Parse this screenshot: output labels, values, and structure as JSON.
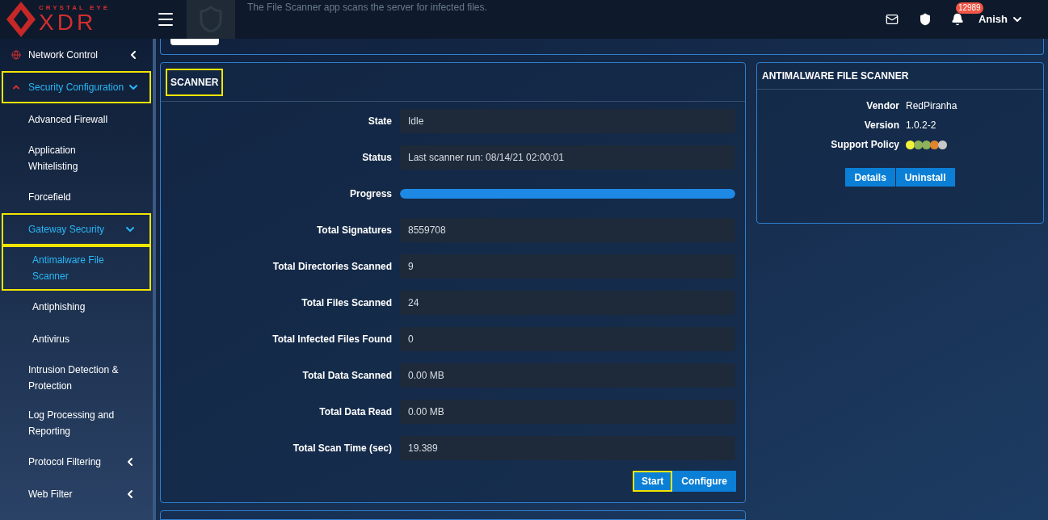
{
  "header": {
    "logo_top": "CRYSTAL EYE",
    "logo_main": "XDR",
    "app_description": "The File Scanner app scans the server for infected files.",
    "notification_count": "12989",
    "user": "Anish"
  },
  "sidebar": {
    "items": [
      {
        "label": "Network Control",
        "expanded": false,
        "highlighted": false,
        "selected": false
      },
      {
        "label": "Security Configuration",
        "expanded": true,
        "highlighted": true,
        "selected": true,
        "children": [
          {
            "label": "Advanced Firewall",
            "highlighted": false,
            "selected": false
          },
          {
            "label": "Application Whitelisting",
            "highlighted": false,
            "selected": false
          },
          {
            "label": "Forcefield",
            "highlighted": false,
            "selected": false
          },
          {
            "label": "Gateway Security",
            "expanded": true,
            "highlighted": true,
            "selected": true,
            "children": [
              {
                "label": "Antimalware File Scanner",
                "highlighted": true,
                "selected": true
              },
              {
                "label": "Antiphishing",
                "highlighted": false,
                "selected": false
              },
              {
                "label": "Antivirus",
                "highlighted": false,
                "selected": false
              }
            ]
          },
          {
            "label": "Intrusion Detection & Protection",
            "highlighted": false,
            "selected": false
          },
          {
            "label": "Log Processing and Reporting",
            "highlighted": false,
            "selected": false
          },
          {
            "label": "Protocol Filtering",
            "expanded": false,
            "highlighted": false,
            "selected": false
          },
          {
            "label": "Web Filter",
            "expanded": false,
            "highlighted": false,
            "selected": false
          }
        ]
      }
    ]
  },
  "scanner": {
    "title": "SCANNER",
    "title_highlighted": true,
    "rows": [
      {
        "kind": "text",
        "label": "State",
        "value": "Idle"
      },
      {
        "kind": "text",
        "label": "Status",
        "value": "Last scanner run: 08/14/21 02:00:01"
      },
      {
        "kind": "progress",
        "label": "Progress",
        "level": 1
      },
      {
        "kind": "text",
        "label": "Total Signatures",
        "value": "8559708"
      },
      {
        "kind": "text",
        "label": "Total Directories Scanned",
        "value": "9"
      },
      {
        "kind": "text",
        "label": "Total Files Scanned",
        "value": "24"
      },
      {
        "kind": "text",
        "label": "Total Infected Files Found",
        "value": "0"
      },
      {
        "kind": "text",
        "label": "Total Data Scanned",
        "value": "0.00 MB"
      },
      {
        "kind": "text",
        "label": "Total Data Read",
        "value": "0.00 MB"
      },
      {
        "kind": "text",
        "label": "Total Scan Time (sec)",
        "value": "19.389"
      }
    ],
    "buttons": [
      {
        "label": "Start",
        "highlighted": true
      },
      {
        "label": "Configure",
        "highlighted": false
      }
    ]
  },
  "app_info": {
    "title": "ANTIMALWARE FILE SCANNER",
    "vendor_label": "Vendor",
    "vendor": "RedPiranha",
    "version_label": "Version",
    "version": "1.0.2-2",
    "support_label": "Support Policy",
    "support_dots": [
      {
        "color": "#f2f23a"
      },
      {
        "color": "#8fb35a"
      },
      {
        "color": "#8fb35a"
      },
      {
        "color": "#e0852e"
      },
      {
        "color": "#c8c8c8"
      }
    ],
    "buttons": [
      "Details",
      "Uninstall"
    ]
  }
}
